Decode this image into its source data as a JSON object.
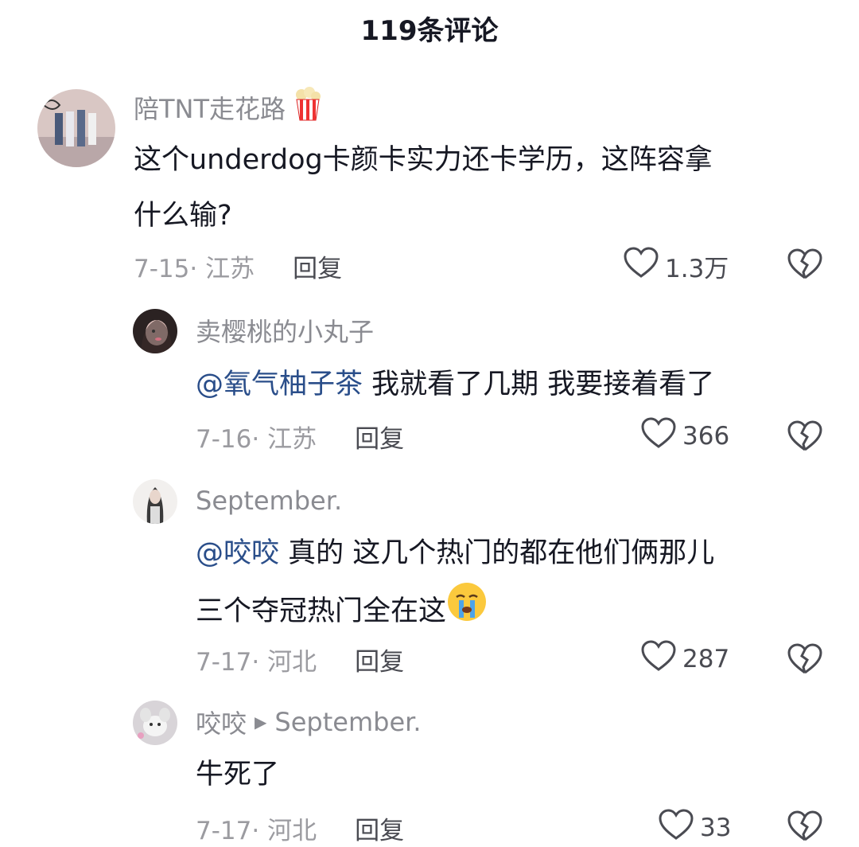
{
  "header": {
    "title": "119条评论"
  },
  "comments": [
    {
      "author": "陪TNT走花路",
      "author_emoji": "popcorn-icon",
      "text_line1": "这个underdog卡颜卡实力还卡学历，这阵容拿",
      "text_line2": "什么输?",
      "date_loc": "7-15· 江苏",
      "reply": "回复",
      "likes": "1.3万"
    },
    {
      "author": "卖樱桃的小丸子",
      "mention": "@氧气柚子茶",
      "text": " 我就看了几期  我要接着看了",
      "date_loc": "7-16· 江苏",
      "reply": "回复",
      "likes": "366"
    },
    {
      "author": "September.",
      "mention": "@咬咬",
      "text_line1": " 真的 这几个热门的都在他们俩那儿",
      "text_line2": "三个夺冠热门全在这",
      "text_emoji": "crying-face-icon",
      "date_loc": "7-17· 河北",
      "reply": "回复",
      "likes": "287"
    },
    {
      "author": "咬咬",
      "reply_to": "September.",
      "text": "牛死了",
      "date_loc": "7-17· 河北",
      "reply": "回复",
      "likes": "33"
    }
  ]
}
